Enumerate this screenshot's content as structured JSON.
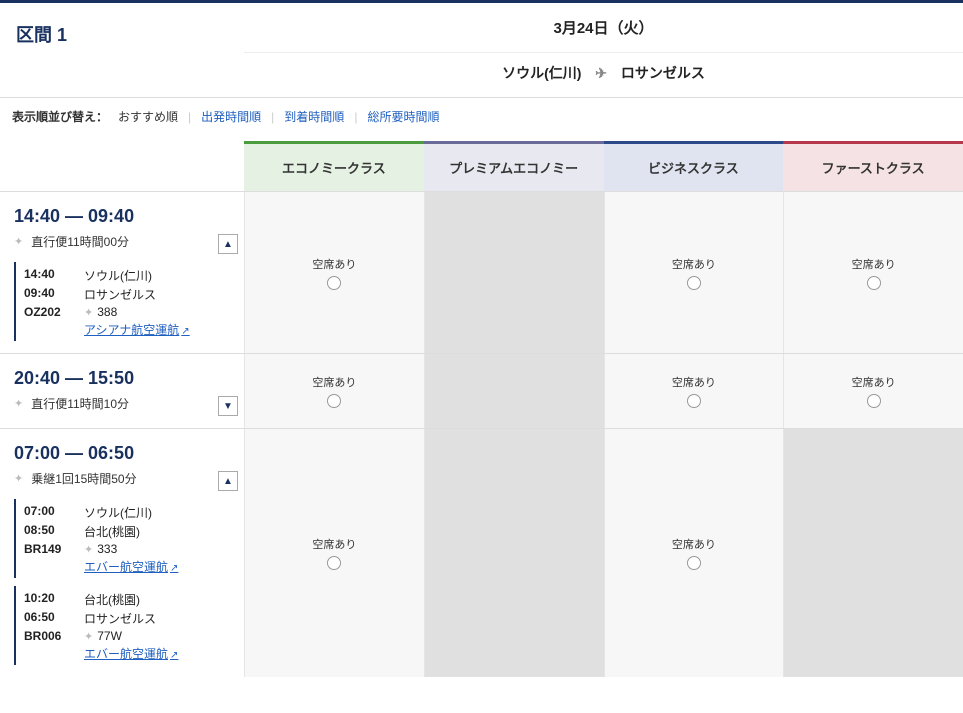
{
  "segment_label": "区間 1",
  "date": "3月24日（火）",
  "route": {
    "from": "ソウル(仁川)",
    "to": "ロサンゼルス"
  },
  "sort": {
    "label": "表示順並び替え：",
    "recommended": "おすすめ順",
    "departure": "出発時間順",
    "arrival": "到着時間順",
    "duration": "総所要時間順"
  },
  "classes": {
    "economy": "エコノミークラス",
    "premium": "プレミアムエコノミー",
    "business": "ビジネスクラス",
    "first": "ファーストクラス"
  },
  "avail_text": "空席あり",
  "flights": [
    {
      "dep": "14:40",
      "arr": "09:40",
      "duration": "直行便11時間00分",
      "expanded": true,
      "legs": [
        {
          "t1": "14:40",
          "t2": "09:40",
          "city1": "ソウル(仁川)",
          "city2": "ロサンゼルス",
          "flight": "OZ202",
          "equip": "388",
          "carrier": "アシアナ航空運航"
        }
      ],
      "cells": {
        "eco": true,
        "pre": false,
        "biz": true,
        "fir": true
      }
    },
    {
      "dep": "20:40",
      "arr": "15:50",
      "duration": "直行便11時間10分",
      "expanded": false,
      "legs": [],
      "cells": {
        "eco": true,
        "pre": false,
        "biz": true,
        "fir": true
      }
    },
    {
      "dep": "07:00",
      "arr": "06:50",
      "duration": "乗継1回15時間50分",
      "expanded": true,
      "legs": [
        {
          "t1": "07:00",
          "t2": "08:50",
          "city1": "ソウル(仁川)",
          "city2": "台北(桃園)",
          "flight": "BR149",
          "equip": "333",
          "carrier": "エバー航空運航"
        },
        {
          "t1": "10:20",
          "t2": "06:50",
          "city1": "台北(桃園)",
          "city2": "ロサンゼルス",
          "flight": "BR006",
          "equip": "77W",
          "carrier": "エバー航空運航"
        }
      ],
      "cells": {
        "eco": true,
        "pre": false,
        "biz": true,
        "fir": false
      }
    }
  ]
}
